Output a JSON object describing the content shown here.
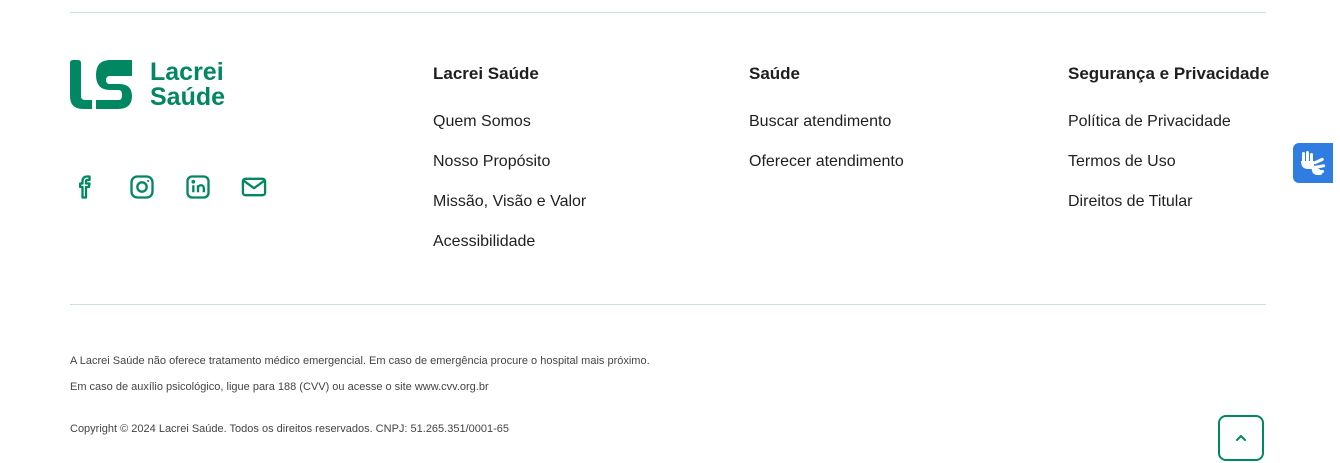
{
  "brand": {
    "line1": "Lacrei",
    "line2": "Saúde",
    "color": "#018762"
  },
  "social": [
    {
      "icon": "facebook-icon"
    },
    {
      "icon": "instagram-icon"
    },
    {
      "icon": "linkedin-icon"
    },
    {
      "icon": "mail-icon"
    }
  ],
  "columns": [
    {
      "title": "Lacrei Saúde",
      "links": [
        "Quem Somos",
        "Nosso Propósito",
        "Missão, Visão e Valor",
        "Acessibilidade"
      ]
    },
    {
      "title": "Saúde",
      "links": [
        "Buscar atendimento",
        "Oferecer atendimento"
      ]
    },
    {
      "title": "Segurança e Privacidade",
      "links": [
        "Política de Privacidade",
        "Termos de Uso",
        "Direitos de Titular"
      ]
    }
  ],
  "disclaimers": [
    "A Lacrei Saúde não oferece tratamento médico emergencial. Em caso de emergência procure o hospital mais próximo.",
    "Em caso de auxílio psicológico, ligue para 188 (CVV) ou acesse o site www.cvv.org.br"
  ],
  "copyright": "Copyright © 2024 Lacrei Saúde. Todos os direitos reservados. CNPJ: 51.265.351/0001-65",
  "back_to_top_icon": "chevron-up-icon",
  "accessibility_icon": "sign-language-hands-icon",
  "accessibility_color": "#2f7de1"
}
